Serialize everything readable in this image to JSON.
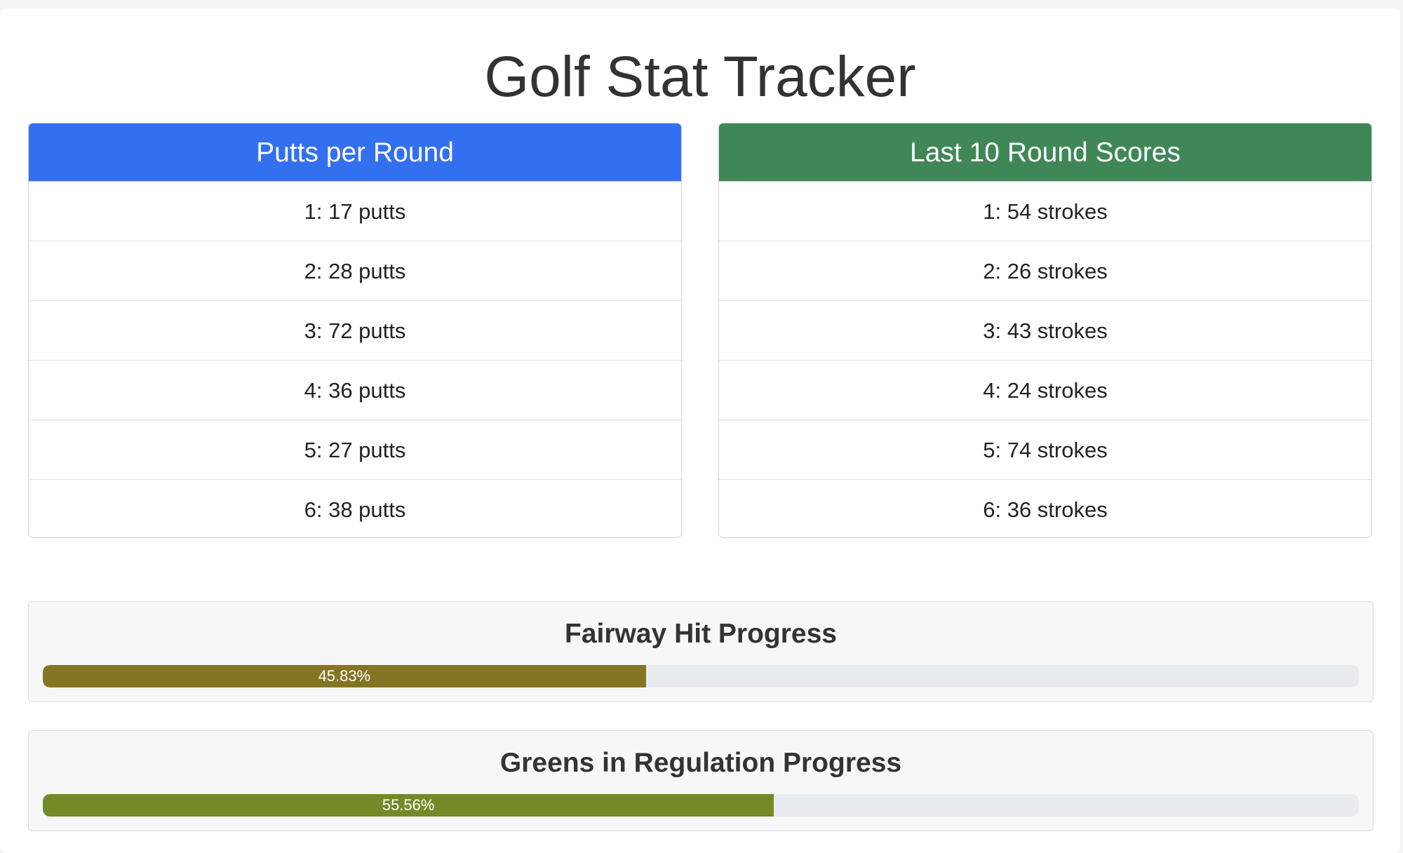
{
  "page": {
    "title": "Golf Stat Tracker"
  },
  "putts_card": {
    "header": "Putts per Round",
    "header_color": "#3370f0",
    "items": [
      "1: 17 putts",
      "2: 28 putts",
      "3: 72 putts",
      "4: 36 putts",
      "5: 27 putts",
      "6: 38 putts"
    ]
  },
  "scores_card": {
    "header": "Last 10 Round Scores",
    "header_color": "#3f8757",
    "items": [
      "1: 54 strokes",
      "2: 26 strokes",
      "3: 43 strokes",
      "4: 24 strokes",
      "5: 74 strokes",
      "6: 36 strokes"
    ]
  },
  "fairway_progress": {
    "title": "Fairway Hit Progress",
    "label": "45.83%",
    "percent": 45.83,
    "bar_color": "#847522"
  },
  "greens_progress": {
    "title": "Greens in Regulation Progress",
    "label": "55.56%",
    "percent": 55.56,
    "bar_color": "#748a27"
  }
}
